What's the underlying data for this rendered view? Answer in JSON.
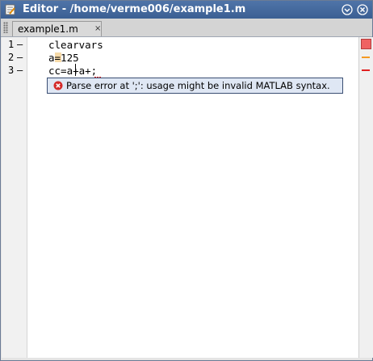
{
  "window": {
    "title": "Editor - /home/verme006/example1.m",
    "icons": [
      "document-icon",
      "menu-circle-icon",
      "close-circle-icon"
    ]
  },
  "tabs": [
    {
      "label": "example1.m",
      "close_label": "×"
    }
  ],
  "editor": {
    "lines": [
      {
        "number": "1",
        "marker": "–",
        "text": "clearvars"
      },
      {
        "number": "2",
        "marker": "–",
        "text": "a=125"
      },
      {
        "number": "3",
        "marker": "–",
        "text": "cc=a+a+;"
      }
    ]
  },
  "tooltip": {
    "icon": "error-icon",
    "message": "Parse error at ';': usage might be invalid MATLAB syntax."
  },
  "colors": {
    "titlebar": "#4f74a8",
    "error": "#e02020",
    "warning": "#f59a23",
    "tooltip_bg": "#dfe7f4"
  }
}
